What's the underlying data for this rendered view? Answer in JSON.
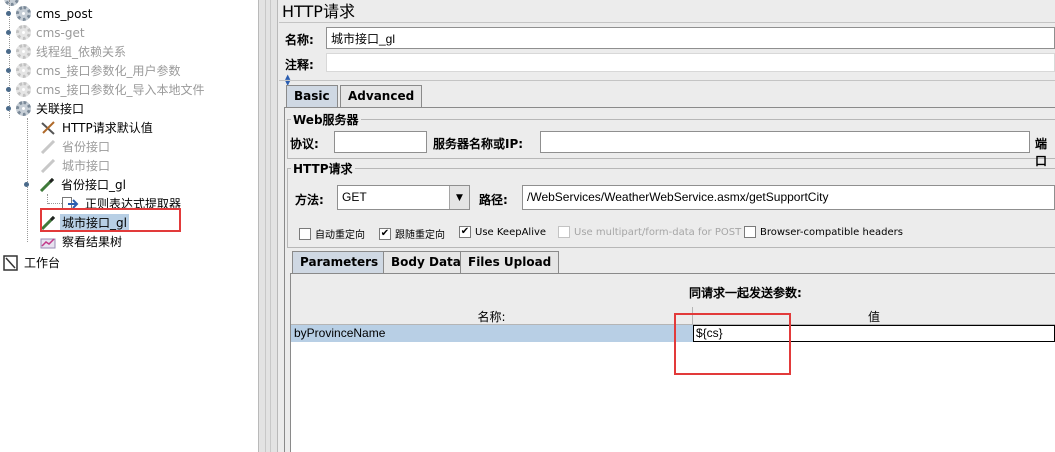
{
  "tree": {
    "items": [
      {
        "label": "cms_post",
        "muted": false
      },
      {
        "label": "cms-get",
        "muted": true
      },
      {
        "label": "线程组_依赖关系",
        "muted": true
      },
      {
        "label": "cms_接口参数化_用户参数",
        "muted": true
      },
      {
        "label": "cms_接口参数化_导入本地文件",
        "muted": true
      },
      {
        "label": "关联接口",
        "muted": false
      }
    ],
    "children": [
      {
        "label": "HTTP请求默认值"
      },
      {
        "label": "省份接口"
      },
      {
        "label": "城市接口"
      },
      {
        "label": "省份接口_gl"
      },
      {
        "label": "正则表达式提取器"
      },
      {
        "label": "城市接口_gl"
      },
      {
        "label": "察看结果树"
      }
    ],
    "workbench": "工作台"
  },
  "panel": {
    "title": "HTTP请求",
    "name_label": "名称:",
    "name_value": "城市接口_gl",
    "comment_label": "注释:",
    "comment_value": "",
    "tabs": [
      "Basic",
      "Advanced"
    ],
    "web_server": {
      "legend": "Web服务器",
      "protocol_label": "协议:",
      "protocol_value": "",
      "server_label": "服务器名称或IP:",
      "server_value": "",
      "port_label": "端口"
    },
    "http_request": {
      "legend": "HTTP请求",
      "method_label": "方法:",
      "method_value": "GET",
      "path_label": "路径:",
      "path_value": "/WebServices/WeatherWebService.asmx/getSupportCity"
    },
    "options": [
      {
        "label": "自动重定向",
        "checked": false,
        "disabled": false
      },
      {
        "label": "跟随重定向",
        "checked": true,
        "disabled": false
      },
      {
        "label": "Use KeepAlive",
        "checked": true,
        "disabled": false
      },
      {
        "label": "Use multipart/form-data for POST",
        "checked": false,
        "disabled": true
      },
      {
        "label": "Browser-compatible headers",
        "checked": false,
        "disabled": false
      }
    ],
    "param_tabs": [
      "Parameters",
      "Body Data",
      "Files Upload"
    ],
    "params": {
      "caption": "同请求一起发送参数:",
      "col_name": "名称:",
      "col_value": "值",
      "rows": [
        {
          "name": "byProvinceName",
          "value": "${cs}"
        }
      ]
    }
  },
  "colors": {
    "highlight_red": "#e23a3a",
    "selection_blue": "#b8cfe5",
    "active_tab": "#cfd8e3"
  }
}
